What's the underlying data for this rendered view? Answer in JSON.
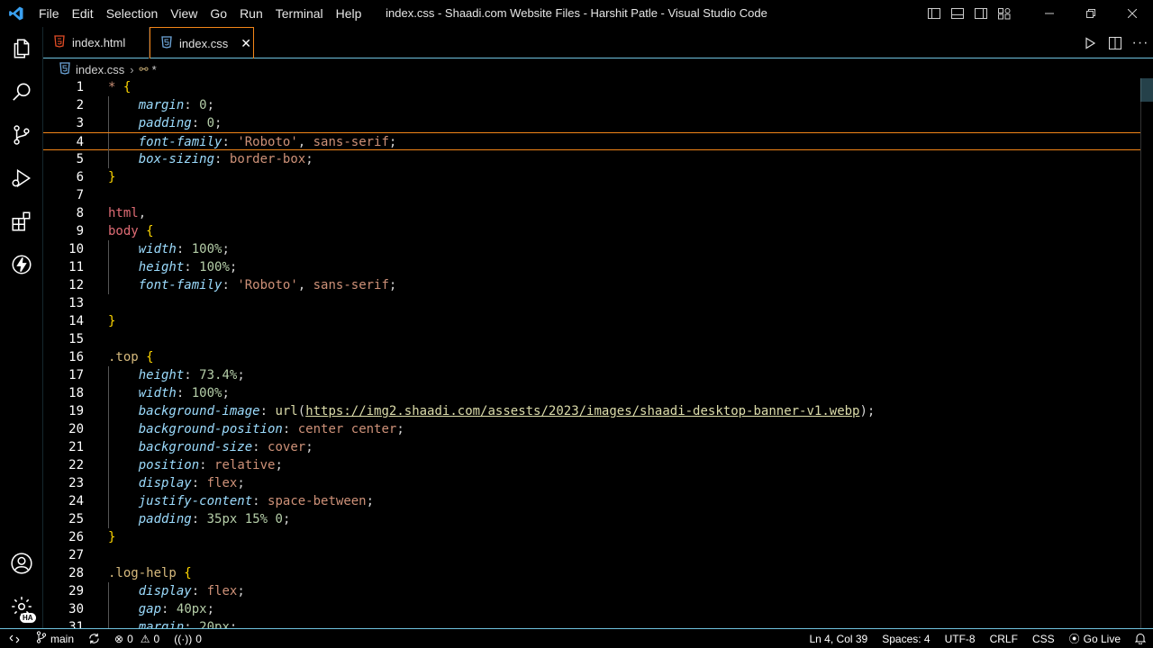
{
  "titlebar": {
    "title": "index.css - Shaadi.com Website Files - Harshit Patle - Visual Studio Code",
    "menu": [
      "File",
      "Edit",
      "Selection",
      "View",
      "Go",
      "Run",
      "Terminal",
      "Help"
    ]
  },
  "tabs": [
    {
      "label": "index.html",
      "icon": "html5-icon",
      "active": false
    },
    {
      "label": "index.css",
      "icon": "css-icon",
      "active": true
    }
  ],
  "breadcrumb": {
    "file": "index.css",
    "symbol": "*"
  },
  "account_badge": "HA",
  "editor": {
    "current_line": 4,
    "lines": [
      "* {",
      "    margin: 0;",
      "    padding: 0;",
      "    font-family: 'Roboto', sans-serif;",
      "    box-sizing: border-box;",
      "}",
      "",
      "html,",
      "body {",
      "    width: 100%;",
      "    height: 100%;",
      "    font-family: 'Roboto', sans-serif;",
      "",
      "}",
      "",
      ".top {",
      "    height: 73.4%;",
      "    width: 100%;",
      "    background-image: url(https://img2.shaadi.com/assests/2023/images/shaadi-desktop-banner-v1.webp);",
      "    background-position: center center;",
      "    background-size: cover;",
      "    position: relative;",
      "    display: flex;",
      "    justify-content: space-between;",
      "    padding: 35px 15% 0;",
      "}",
      "",
      ".log-help {",
      "    display: flex;",
      "    gap: 40px;",
      "    margin: 20px;"
    ]
  },
  "statusbar": {
    "branch": "main",
    "errors": "0",
    "warnings": "0",
    "ports": "0",
    "position": "Ln 4, Col 39",
    "spaces": "Spaces: 4",
    "encoding": "UTF-8",
    "eol": "CRLF",
    "language": "CSS",
    "golive": "Go Live"
  },
  "colors": {
    "accent": "#6fc3df",
    "active_border": "#f38518",
    "selector": "#d7ba7d",
    "property": "#9cdcfe",
    "number": "#b5cea8",
    "string": "#ce9178"
  }
}
